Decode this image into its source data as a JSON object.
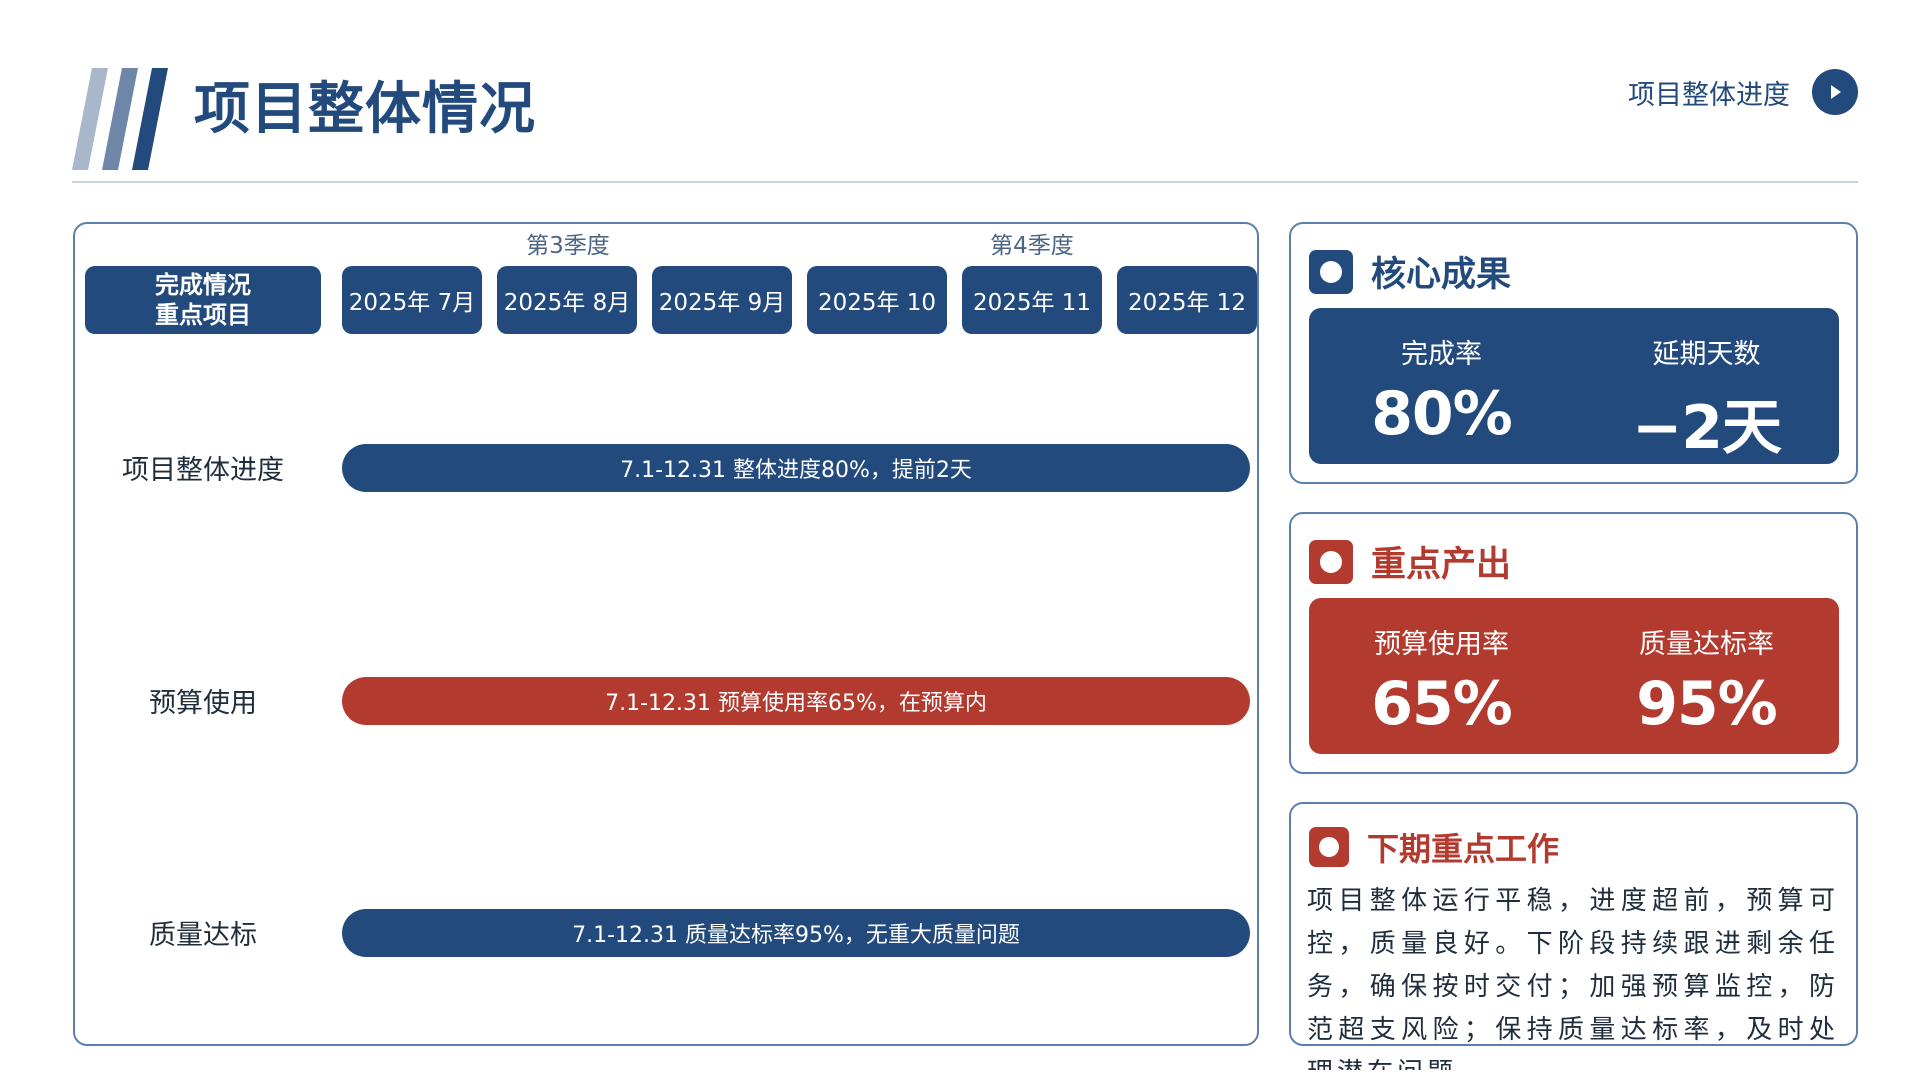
{
  "header": {
    "title": "项目整体情况",
    "nav_label": "项目整体进度"
  },
  "gantt": {
    "quarters": [
      "第3季度",
      "第4季度"
    ],
    "corner_line1": "完成情况",
    "corner_line2": "重点项目",
    "months": [
      "2025年 7月",
      "2025年 8月",
      "2025年 9月",
      "2025年 10",
      "2025年 11",
      "2025年 12"
    ],
    "rows": [
      {
        "label": "项目整体进度",
        "bar_text": "7.1-12.31 整体进度80%，提前2天",
        "color": "#234a7c"
      },
      {
        "label": "预算使用",
        "bar_text": "7.1-12.31 预算使用率65%，在预算内",
        "color": "#b23a2e"
      },
      {
        "label": "质量达标",
        "bar_text": "7.1-12.31 质量达标率95%，无重大质量问题",
        "color": "#234a7c"
      }
    ]
  },
  "core_results": {
    "title": "核心成果",
    "metrics": [
      {
        "label": "完成率",
        "value": "80%"
      },
      {
        "label": "延期天数",
        "value": "−2天"
      }
    ]
  },
  "key_outputs": {
    "title": "重点产出",
    "metrics": [
      {
        "label": "预算使用率",
        "value": "65%"
      },
      {
        "label": "质量达标率",
        "value": "95%"
      }
    ]
  },
  "next_work": {
    "title": "下期重点工作",
    "text": "项目整体运行平稳，进度超前，预算可控，质量良好。下阶段持续跟进剩余任务，确保按时交付；加强预算监控，防范超支风险；保持质量达标率，及时处理潜在问题。"
  },
  "colors": {
    "navy": "#234a7c",
    "red": "#b23a2e",
    "border": "#5a7fae"
  }
}
